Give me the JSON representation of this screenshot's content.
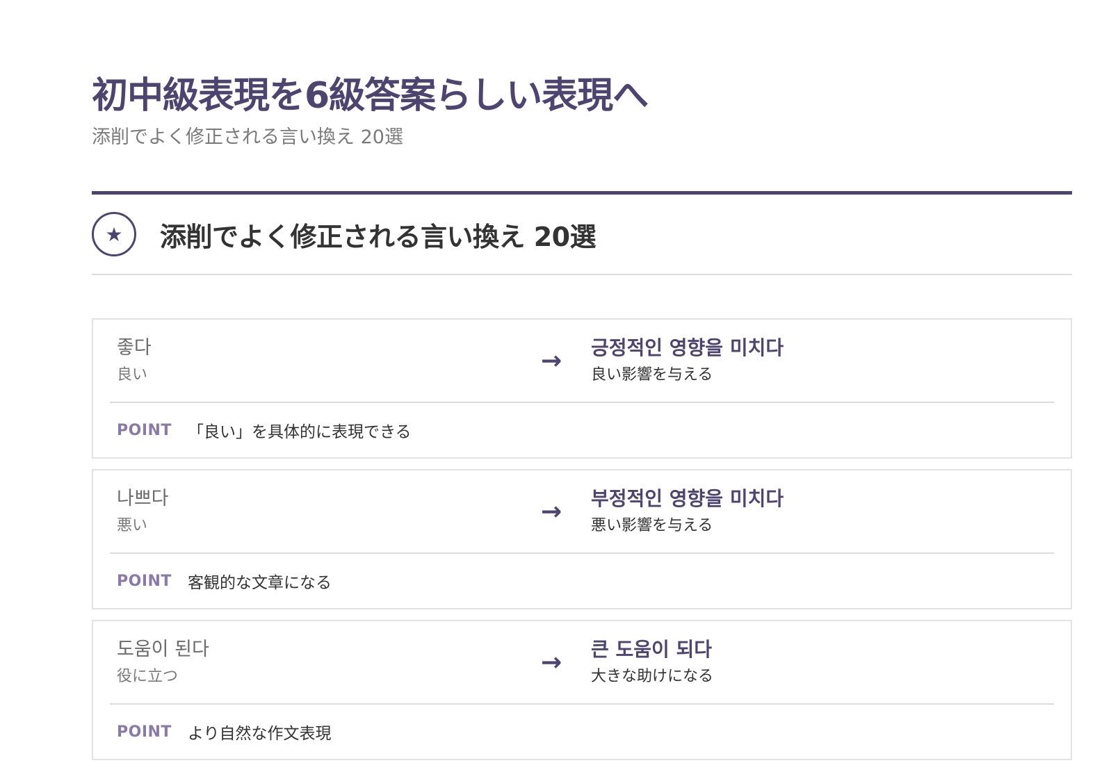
{
  "header": {
    "title": "初中級表現を6級答案らしい表現へ",
    "subtitle": "添削でよく修正される言い換え 20選"
  },
  "section": {
    "icon": "star-icon",
    "title": "添削でよく修正される言い換え 20選"
  },
  "cards": [
    {
      "orig_ko": "좋다",
      "orig_ja": "良い",
      "arrow": "→",
      "new_ko": "긍정적인 영향을 미치다",
      "new_ja": "良い影響を与える",
      "point_label": "POINT",
      "point_text": "「良い」を具体的に表現できる"
    },
    {
      "orig_ko": "나쁘다",
      "orig_ja": "悪い",
      "arrow": "→",
      "new_ko": "부정적인 영향을 미치다",
      "new_ja": "悪い影響を与える",
      "point_label": "POINT",
      "point_text": "客観的な文章になる"
    },
    {
      "orig_ko": "도움이 된다",
      "orig_ja": "役に立つ",
      "arrow": "→",
      "new_ko": "큰 도움이 되다",
      "new_ja": "大きな助けになる",
      "point_label": "POINT",
      "point_text": "より自然な作文表現"
    }
  ],
  "colors": {
    "accent": "#4e4470",
    "point": "#8a7aa8"
  }
}
